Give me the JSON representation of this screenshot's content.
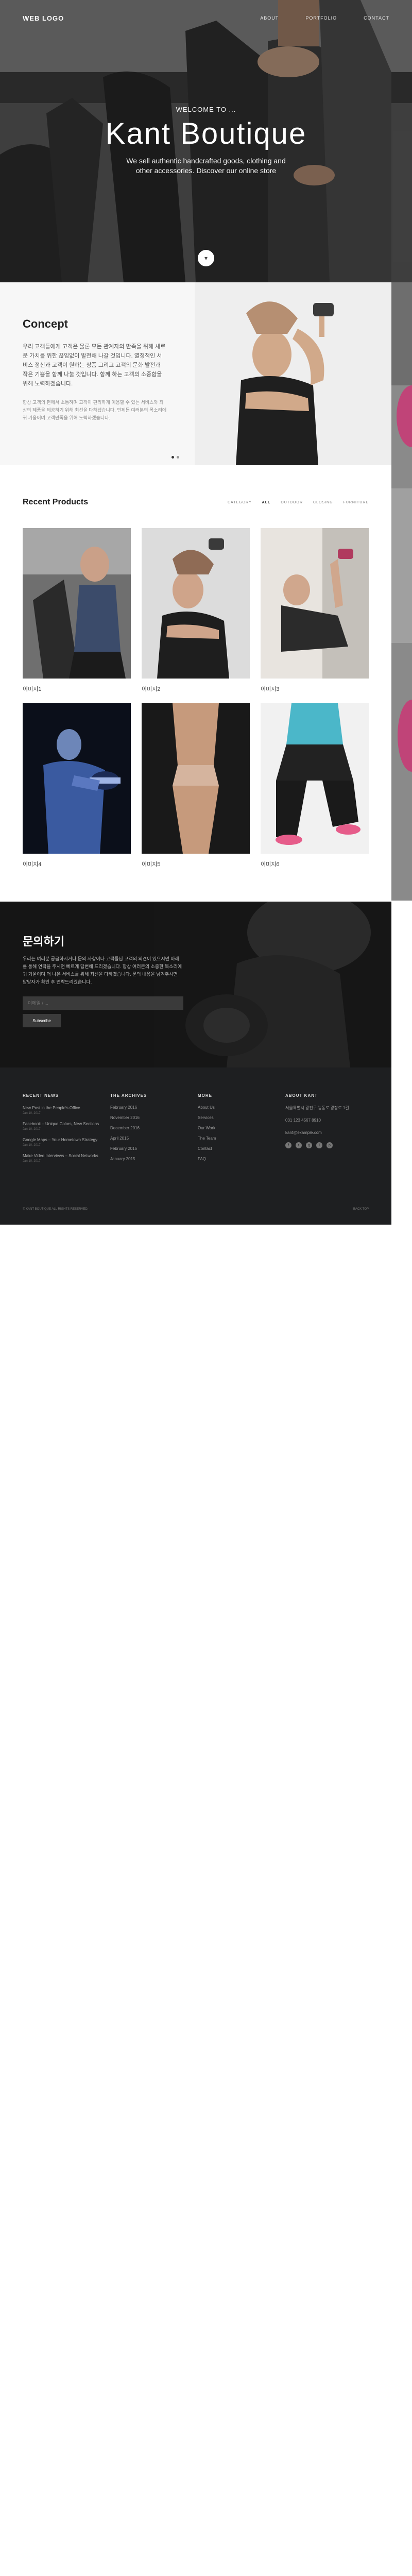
{
  "nav": {
    "logo": "WEB LOGO",
    "menu": [
      "ABOUT",
      "PORTFOLIO",
      "CONTACT"
    ]
  },
  "hero": {
    "subtitle": "WELCOME TO ...",
    "title": "Kant Boutique",
    "description": "We sell authentic handcrafted goods, clothing and other accessories. Discover our online store"
  },
  "concept": {
    "title": "Concept",
    "paragraph1": "우리 고객들에게 고객은 물론 모든 관계자의 만족을 위해 새로운 가치를 위한 끊임없이 발전해 나갈 것입니다. 열정적인 서비스 정신과 고객이 원하는 상품 그리고 고객의 문화 발전과 작은 기쁨을 함께 나눌 것입니다. 함께 하는 고객의 소중함을 위해 노력하겠습니다.",
    "paragraph2": "항상 고객의 편에서 소통하며 고객이 편리하게 이용할 수 있는 서비스와 최상의 제품을 제공하기 위해 최선을 다하겠습니다. 언제든 여러분의 목소리에 귀 기울이며 고객만족을 위해 노력하겠습니다."
  },
  "products": {
    "title": "Recent Products",
    "filters": [
      "CATEGORY",
      "ALL",
      "OUTDOOR",
      "CLOSING",
      "FURNITURE"
    ],
    "active_filter": "ALL",
    "items": [
      {
        "caption": "이미지1"
      },
      {
        "caption": "이미지2"
      },
      {
        "caption": "이미지3"
      },
      {
        "caption": "이미지4"
      },
      {
        "caption": "이미지5"
      },
      {
        "caption": "이미지6"
      }
    ]
  },
  "contact": {
    "title": "문의하기",
    "description": "우리는 여러분 궁금하시거나 문의 사항이나 고객들님 고객의 의견이 있으시면 아래를 통해 연락을 주시면 빠르게 답변해 드리겠습니다. 항상 여러분의 소중한 목소리에 귀 기울이며 더 나은 서비스를 위해 최선을 다하겠습니다. 문의 내용을 남겨주시면 담당자가 확인 후 연락드리겠습니다.",
    "input_placeholder": "이메일 / ...",
    "submit_label": "Subscribe"
  },
  "footer": {
    "recent_head": "RECENT NEWS",
    "recent_posts": [
      {
        "title": "New Post in the People's Office",
        "date": "Jan 10, 2017"
      },
      {
        "title": "Facebook – Unique Colors, New Sections",
        "date": "Jan 10, 2017"
      },
      {
        "title": "Google Maps – Your Hometown Strategy",
        "date": "Jan 10, 2017"
      },
      {
        "title": "Make Video Interviews – Social Networks",
        "date": "Jan 10, 2017"
      }
    ],
    "archives_head": "THE ARCHIVES",
    "archives": [
      "February 2016",
      "November 2016",
      "December 2016",
      "April 2015",
      "February 2015",
      "January 2015"
    ],
    "more_head": "MORE",
    "more_links": [
      "About Us",
      "Services",
      "Our Work",
      "The Team",
      "Contact",
      "FAQ"
    ],
    "about_head": "ABOUT KANT",
    "about_address": "서울특별시 광진구 능동로 광장로 1길",
    "about_phone": "031 123 4567 8910",
    "about_email": "kant@example.com",
    "social_icons": [
      "facebook-icon",
      "twitter-icon",
      "google-icon",
      "instagram-icon",
      "pinterest-icon"
    ],
    "copyright": "© KANT BOUTIQUE ALL RIGHTS RESERVED.",
    "to_top": "BACK TOP"
  }
}
